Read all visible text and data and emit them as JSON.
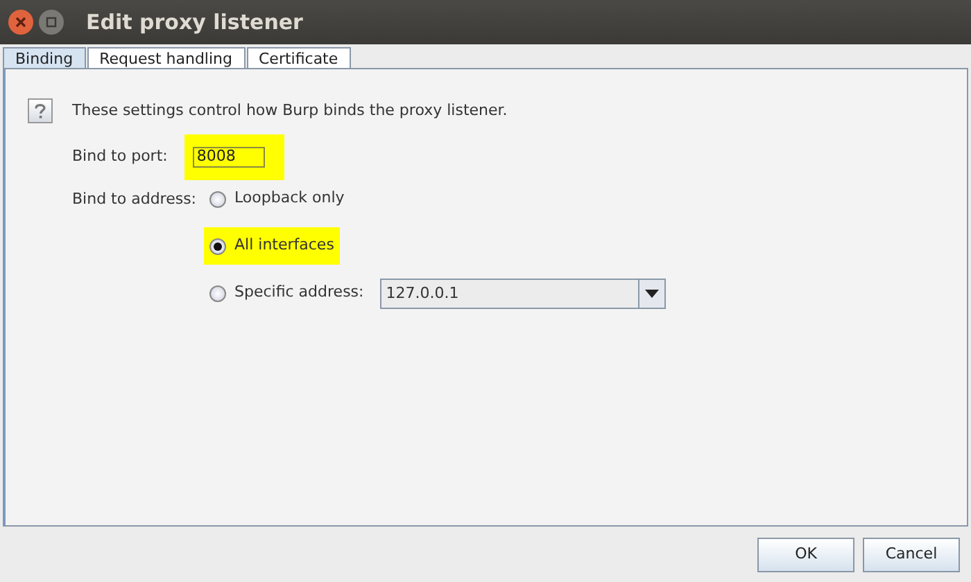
{
  "window": {
    "title": "Edit proxy listener"
  },
  "tabs": [
    {
      "label": "Binding",
      "selected": true
    },
    {
      "label": "Request handling",
      "selected": false
    },
    {
      "label": "Certificate",
      "selected": false
    }
  ],
  "help_text": "These settings control how Burp binds the proxy listener.",
  "port": {
    "label": "Bind to port:",
    "value": "8008",
    "highlighted": true
  },
  "address": {
    "label": "Bind to address:",
    "options": [
      {
        "label": "Loopback only",
        "selected": false,
        "highlighted": false
      },
      {
        "label": "All interfaces",
        "selected": true,
        "highlighted": true
      },
      {
        "label": "Specific address:",
        "selected": false,
        "highlighted": false,
        "dropdown_value": "127.0.0.1"
      }
    ]
  },
  "buttons": [
    "OK",
    "Cancel"
  ]
}
